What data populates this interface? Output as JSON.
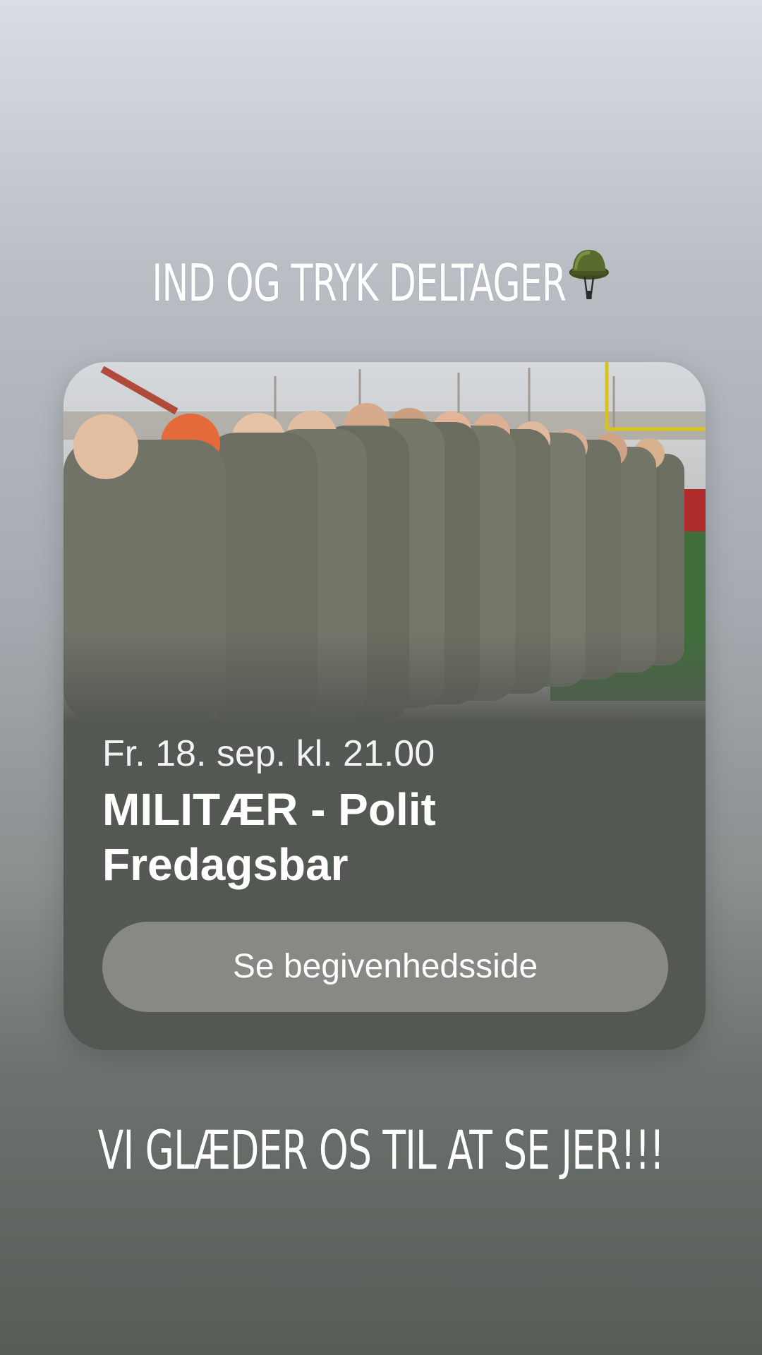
{
  "story": {
    "headline_top": "IND OG TRYK DELTAGER",
    "headline_top_emoji": "military-helmet-icon",
    "headline_bottom": "VI GLÆDER OS TIL AT SE JER!!!"
  },
  "event_card": {
    "date": "Fr. 18. sep. kl. 21.00",
    "title": "MILITÆR - Polit Fredagsbar",
    "button_label": "Se begivenhedsside",
    "photo": "row-of-people-in-camouflage-uniforms"
  },
  "colors": {
    "card_background": "#545853",
    "button_background": "#878a84",
    "text": "#ffffff"
  }
}
